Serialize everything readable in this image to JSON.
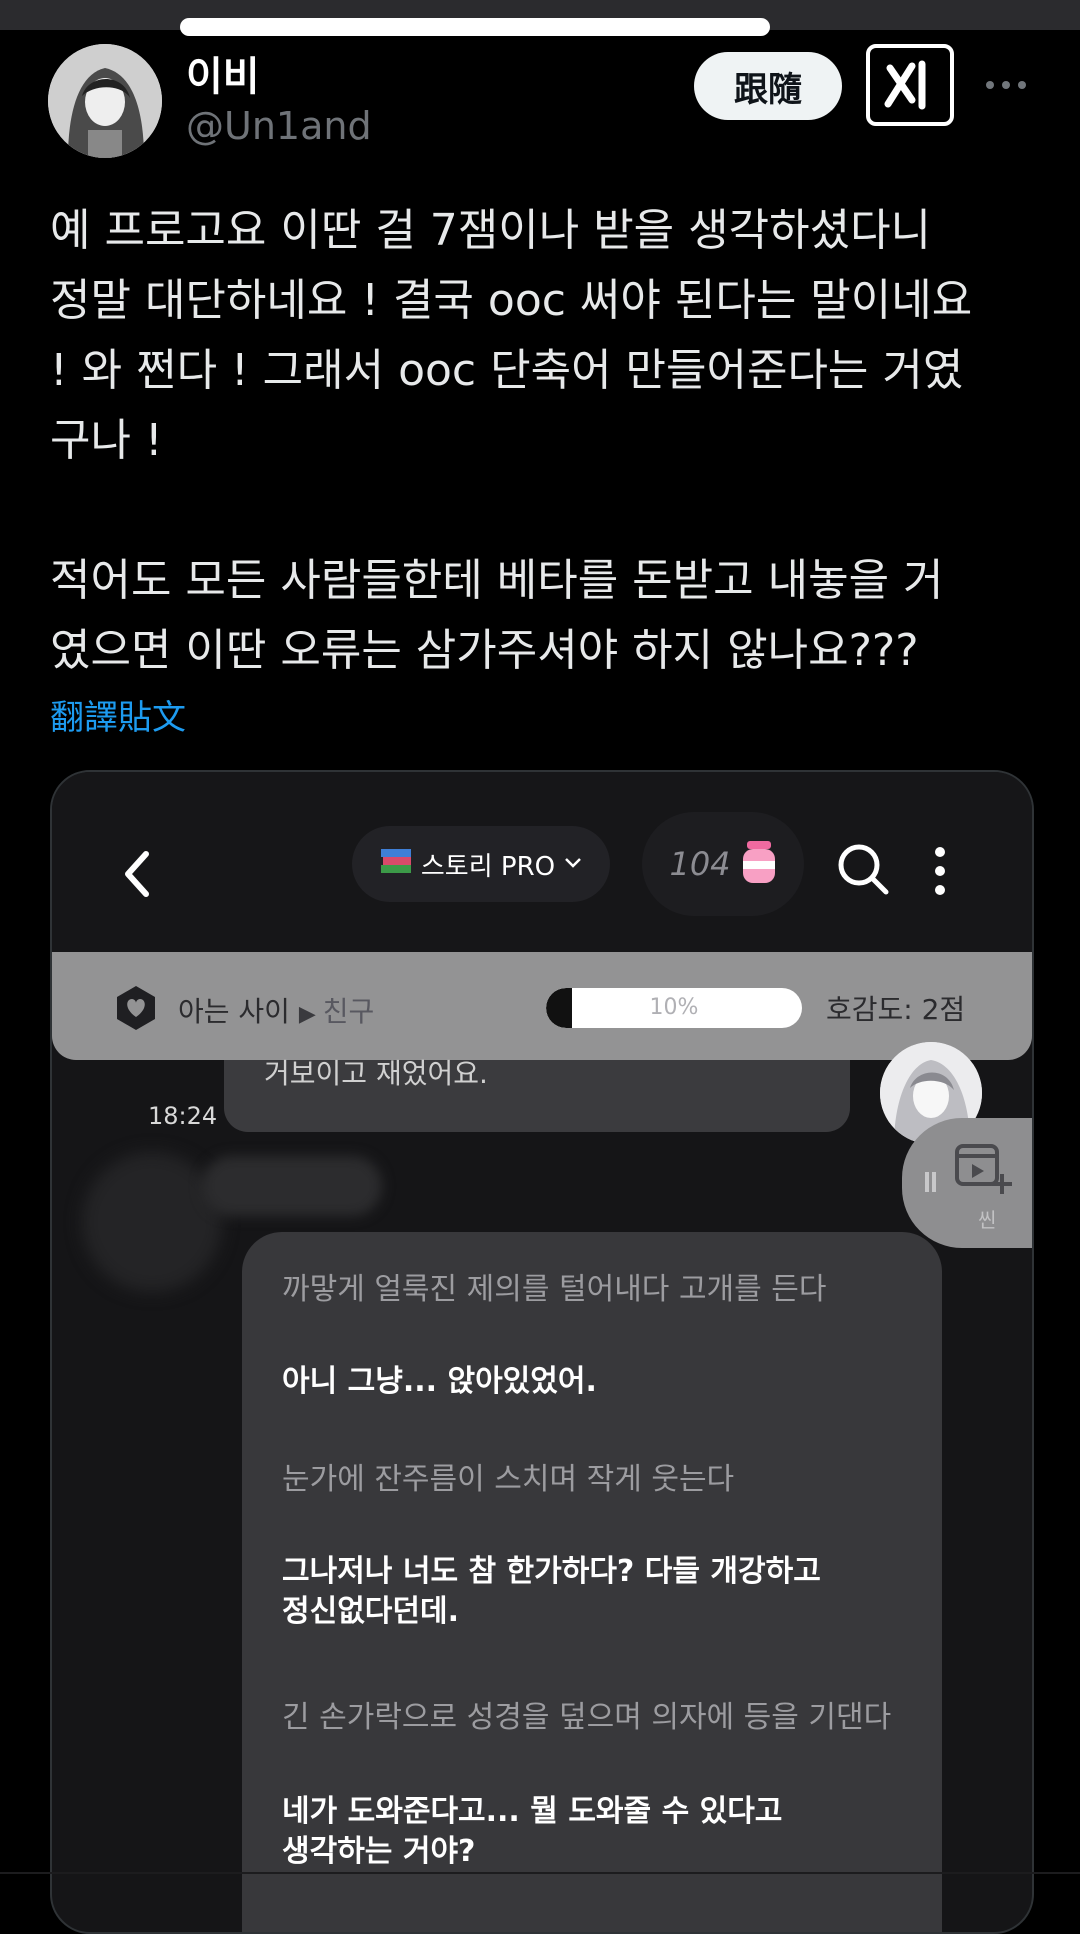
{
  "post": {
    "author_name": "이비",
    "author_handle": "@Un1and",
    "follow_label": "跟隨",
    "text": "예 프로고요 이딴 걸 7잼이나 받을 생각하셨다니\n정말 대단하네요 ! 결국 ooc 써야 된다는 말이네요\n! 와 쩐다 ! 그래서 ooc 단축어 만들어준다는 거였\n구나 !\n\n적어도 모든 사람들한테 베타를 돈받고 내놓을 거\n였으면 이딴 오류는 삼가주셔야 하지 않나요???",
    "translate_label": "翻譯貼文"
  },
  "screenshot": {
    "story_label": "스토리 PRO",
    "coin_count": "104",
    "relation_current": "아는 사이",
    "relation_next": "친구",
    "progress_text": "10%",
    "progress_value": 0.1,
    "affinity_text": "호감도: 2점",
    "prev_message_partial": "거보이고 재었어요.",
    "message_time": "18:24",
    "scene_label": "씬",
    "messages": [
      {
        "type": "narration",
        "text": "까맣게 얼룩진 제의를 털어내다 고개를 든다"
      },
      {
        "type": "speech",
        "text": "아니 그냥... 앉아있었어."
      },
      {
        "type": "narration",
        "text": "눈가에 잔주름이 스치며 작게 웃는다"
      },
      {
        "type": "speech",
        "text": "그나저나 너도 참 한가하다? 다들 개강하고\n정신없다던데."
      },
      {
        "type": "narration",
        "text": "긴 손가락으로 성경을 덮으며 의자에 등을 기댄다"
      },
      {
        "type": "speech",
        "text": "네가 도와준다고... 뭘 도와줄 수 있다고\n생각하는 거야?"
      }
    ]
  },
  "icons": {
    "grok": "grok-icon",
    "more": "more-horizontal-icon",
    "back": "chevron-left-icon",
    "search": "search-icon",
    "menu": "kebab-menu-icon",
    "heart_badge": "heart-hexagon-icon",
    "coin": "pink-jar-icon",
    "scene": "video-add-icon"
  }
}
